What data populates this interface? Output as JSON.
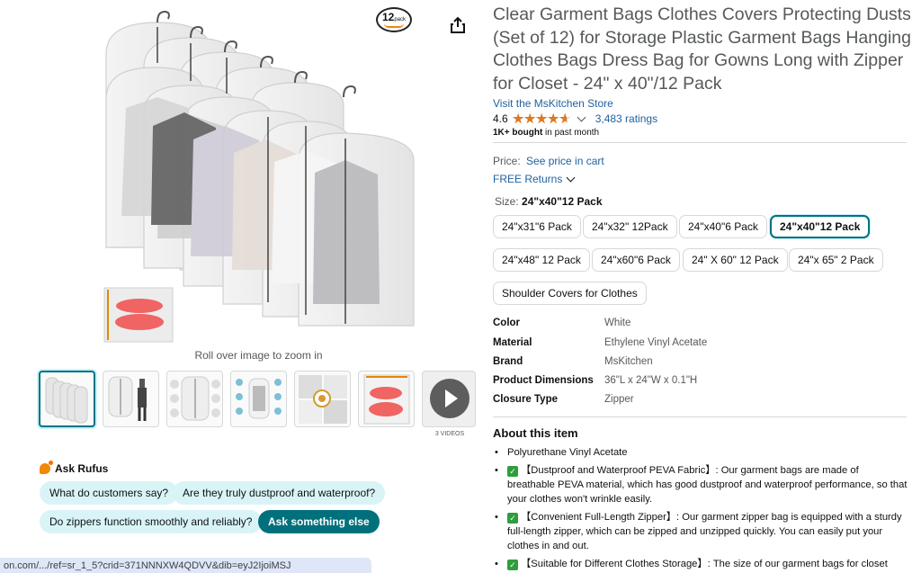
{
  "media": {
    "pack_badge_number": "12",
    "pack_badge_text": "pack",
    "zoom_hint": "Roll over image to zoom in",
    "videos_label": "3 VIDEOS",
    "thumbnail_count": 7
  },
  "rufus": {
    "title": "Ask Rufus",
    "chips": [
      "What do customers say?",
      "Are they truly dustproof and waterproof?",
      "Do zippers function smoothly and reliably?",
      "Ask something else"
    ]
  },
  "status_url": "on.com/.../ref=sr_1_5?crid=371NNNXW4QDVV&dib=eyJ2IjoiMSJ",
  "product": {
    "title": "Clear Garment Bags Clothes Covers Protecting Dusts (Set of 12) for Storage Plastic Garment Bags Hanging Clothes Bags Dress Bag for Gowns Long with Zipper for Closet - 24\" x 40\"/12 Pack",
    "store_link": "Visit the MsKitchen Store",
    "rating": "4.6",
    "ratings_count": "3,483 ratings",
    "bought_bold": "1K+ bought",
    "bought_rest": " in past month",
    "price_label": "Price:",
    "price_link": "See price in cart",
    "returns": "FREE Returns",
    "size_label": "Size:",
    "size_selected": "24\"x40\"12 Pack",
    "sizes": [
      "24\"x31\"6 Pack",
      "24\"x32\" 12Pack",
      "24\"x40\"6 Pack",
      "24\"x40\"12 Pack",
      "24\"x48\" 12 Pack",
      "24\"x60\"6 Pack",
      "24\" X 60\" 12 Pack",
      "24\"x 65\" 2 Pack",
      "Shoulder Covers for Clothes"
    ],
    "specs": [
      {
        "k": "Color",
        "v": "White"
      },
      {
        "k": "Material",
        "v": "Ethylene Vinyl Acetate"
      },
      {
        "k": "Brand",
        "v": "MsKitchen"
      },
      {
        "k": "Product Dimensions",
        "v": "36\"L x 24\"W x 0.1\"H"
      },
      {
        "k": "Closure Type",
        "v": "Zipper"
      }
    ],
    "about_title": "About this item",
    "bullets": [
      "Polyurethane Vinyl Acetate",
      "【Dustproof and Waterproof PEVA Fabric】: Our garment bags are made of breathable PEVA material, which has good dustproof and waterproof performance, so that your clothes won't wrinkle easily.",
      "【Convenient Full-Length Zipper】: Our garment zipper bag is equipped with a sturdy full-length zipper, which can be zipped and unzipped quickly. You can easily put your clothes in and out.",
      "【Suitable for Different Clothes Storage】: The size of our garment bags for closet"
    ]
  },
  "colors": {
    "link": "#2162a1",
    "star": "#de7921",
    "teal": "#007185",
    "chip_bg": "#d9f4f7",
    "chip_dark": "#00717c"
  }
}
